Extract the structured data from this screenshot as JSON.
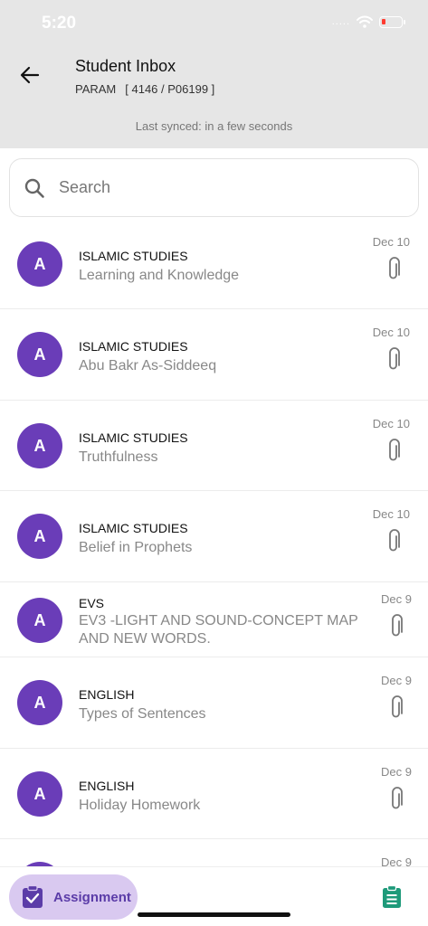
{
  "status": {
    "time": "5:20",
    "signal_dots": "....."
  },
  "header": {
    "title": "Student Inbox",
    "student_name": "PARAM",
    "student_code": "[ 4146 / P06199 ]",
    "last_synced": "Last synced: in a few seconds"
  },
  "search": {
    "placeholder": "Search"
  },
  "messages": [
    {
      "avatar": "A",
      "subject": "ISLAMIC STUDIES",
      "topic": "Learning and Knowledge",
      "date": "Dec 10",
      "attachment_icon": "paperclip-icon"
    },
    {
      "avatar": "A",
      "subject": "ISLAMIC STUDIES",
      "topic": "Abu Bakr As-Siddeeq",
      "date": "Dec 10",
      "attachment_icon": "paperclip-icon"
    },
    {
      "avatar": "A",
      "subject": "ISLAMIC STUDIES",
      "topic": "Truthfulness",
      "date": "Dec 10",
      "attachment_icon": "paperclip-icon"
    },
    {
      "avatar": "A",
      "subject": "ISLAMIC STUDIES",
      "topic": "Belief in Prophets",
      "date": "Dec 10",
      "attachment_icon": "paperclip-icon"
    },
    {
      "avatar": "A",
      "subject": "EVS",
      "topic": "EV3 -LIGHT AND SOUND-CONCEPT MAP AND NEW WORDS.",
      "date": "Dec 9",
      "attachment_icon": "paperclip-icon"
    },
    {
      "avatar": "A",
      "subject": "ENGLISH",
      "topic": "Types of Sentences",
      "date": "Dec 9",
      "attachment_icon": "paperclip-icon"
    },
    {
      "avatar": "A",
      "subject": "ENGLISH",
      "topic": "Holiday Homework",
      "date": "Dec 9",
      "attachment_icon": "paperclip-icon"
    },
    {
      "avatar": "",
      "subject": "",
      "topic": "",
      "date": "Dec 9",
      "attachment_icon": "paperclip-icon"
    }
  ],
  "bottom_nav": {
    "assignment_label": "Assignment",
    "assignment_icon": "clipboard-check-icon",
    "right_icon": "clipboard-list-icon"
  },
  "colors": {
    "accent": "#6a3db8",
    "assignment_pill": "#d9c9f0",
    "clipboard_green": "#1e9a7a",
    "header_bg": "#e6e6e6",
    "battery_low": "#ff3b30"
  }
}
